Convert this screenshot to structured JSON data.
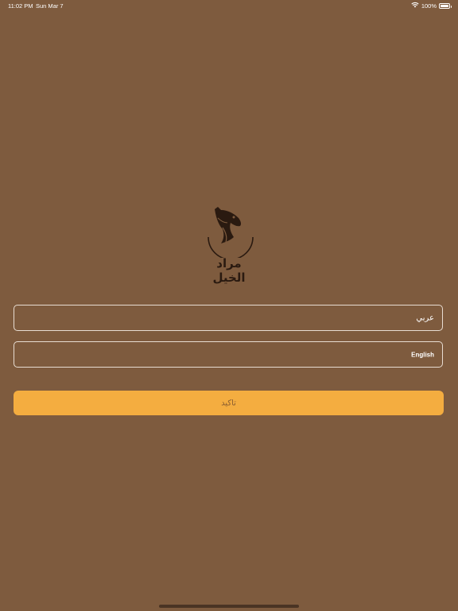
{
  "status_bar": {
    "time": "11:02 PM",
    "date": "Sun Mar 7",
    "battery": "100%"
  },
  "logo": {
    "text": "مراد الخيل"
  },
  "languages": [
    {
      "label": "عربي"
    },
    {
      "label": "English"
    }
  ],
  "confirm_button": {
    "label": "تاكيد"
  },
  "colors": {
    "background": "#7e5b3e",
    "accent": "#f4ad40",
    "logo": "#2a1a10"
  },
  "icons": {
    "wifi": "wifi-icon",
    "battery": "battery-icon",
    "logo": "horse-head-icon"
  }
}
